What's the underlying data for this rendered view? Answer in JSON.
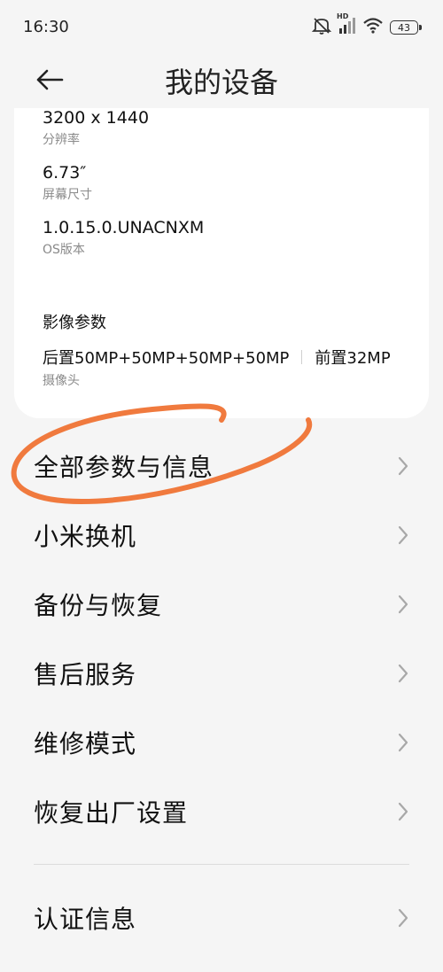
{
  "status": {
    "time": "16:30",
    "battery": "43",
    "hd": "HD"
  },
  "header": {
    "title": "我的设备"
  },
  "specs": [
    {
      "value": "3200 x 1440",
      "label": "分辨率"
    },
    {
      "value": "6.73″",
      "label": "屏幕尺寸"
    },
    {
      "value": "1.0.15.0.UNACNXM",
      "label": "OS版本"
    }
  ],
  "camera": {
    "section_title": "影像参数",
    "rear": "后置50MP+50MP+50MP+50MP",
    "front": "前置32MP",
    "label": "摄像头"
  },
  "menu": [
    {
      "label": "全部参数与信息"
    },
    {
      "label": "小米换机"
    },
    {
      "label": "备份与恢复"
    },
    {
      "label": "售后服务"
    },
    {
      "label": "维修模式"
    },
    {
      "label": "恢复出厂设置"
    },
    {
      "label": "认证信息"
    }
  ],
  "colors": {
    "annotation": "#f07a3e",
    "background": "#f5f5f5",
    "card": "#ffffff"
  },
  "icons": [
    "back-arrow-icon",
    "mute-icon",
    "signal-icon",
    "wifi-icon",
    "battery-icon",
    "chevron-right-icon"
  ]
}
